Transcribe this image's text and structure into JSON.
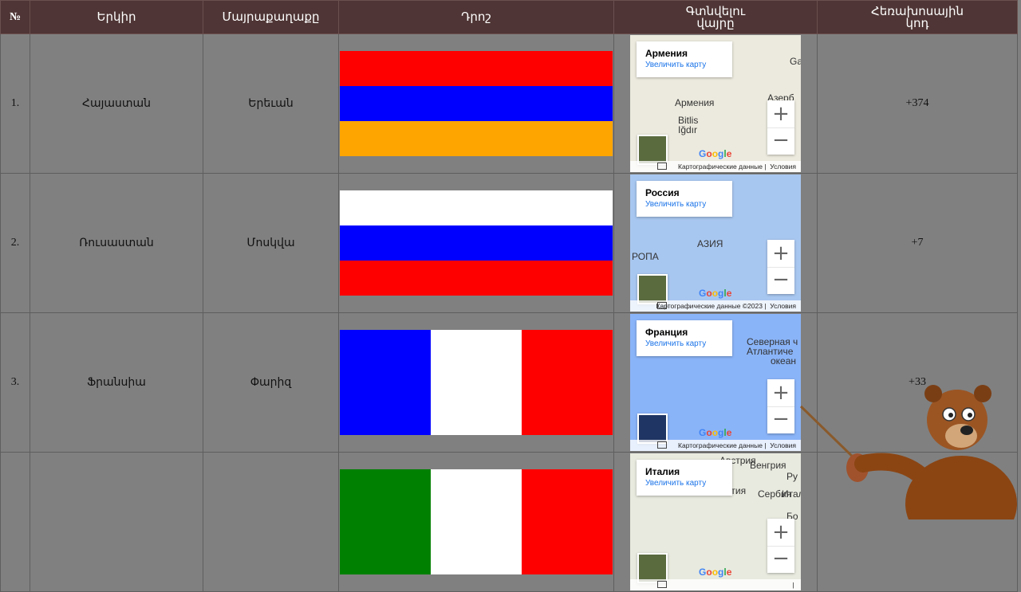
{
  "headers": {
    "no": "№",
    "country": "Երկիր",
    "capital": "Մայրաքաղաքը",
    "flag": "Դրոշ",
    "location_l1": "Գտնվելու",
    "location_l2": "վայրը",
    "code_l1": "Հեռախոսային",
    "code_l2": "կոդ"
  },
  "rows": [
    {
      "num": "1.",
      "country": "Հայաստան",
      "capital": "Երեւան",
      "code": "+374",
      "flag_colors": [
        "#ff0000",
        "#0000ff",
        "#ffa500"
      ],
      "flag_dir": "horizontal",
      "map": {
        "title": "Армения",
        "link": "Увеличить карту",
        "attribution": "Картографические данные",
        "terms": "Условия",
        "labels": [
          "Азерб",
          "Армения",
          "Iğdır",
          "Bitlis",
          "Gai"
        ],
        "bg": "#eceade"
      }
    },
    {
      "num": "2.",
      "country": "Ռուսաստան",
      "capital": "Մոսկվա",
      "code": "+7",
      "flag_colors": [
        "#ffffff",
        "#0000ff",
        "#ff0000"
      ],
      "flag_dir": "horizontal",
      "map": {
        "title": "Россия",
        "link": "Увеличить карту",
        "attribution": "Картографические данные ©2023",
        "terms": "Условия",
        "labels": [
          "АЗИЯ",
          "РОПА"
        ],
        "bg": "#a8c7f0"
      }
    },
    {
      "num": "3.",
      "country": "Ֆրանսիա",
      "capital": "Փարիզ",
      "code": "+33",
      "flag_colors": [
        "#0000ff",
        "#ffffff",
        "#ff0000"
      ],
      "flag_dir": "vertical",
      "map": {
        "title": "Франция",
        "link": "Увеличить карту",
        "attribution": "Картографические данные",
        "terms": "Условия",
        "labels": [
          "Северная ч",
          "Атлантиче",
          "океан"
        ],
        "bg": "#8ab4f8"
      }
    },
    {
      "num": "",
      "country": "",
      "capital": "",
      "code": "",
      "flag_colors": [
        "#008000",
        "#ffffff",
        "#ff0000"
      ],
      "flag_dir": "vertical",
      "map": {
        "title": "Италия",
        "link": "Увеличить карту",
        "attribution": "",
        "terms": "",
        "labels": [
          "Австрия",
          "Венгрия",
          "Италия",
          "Сербия",
          "Ру",
          "Бо",
          "атия"
        ],
        "bg": "#e8eadf"
      }
    }
  ],
  "zoom_in": "+",
  "zoom_out": "−",
  "google_logo": "Google"
}
